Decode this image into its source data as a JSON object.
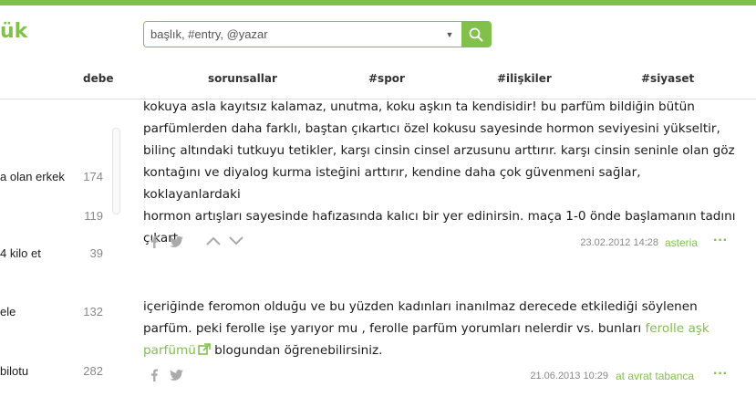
{
  "brand": {
    "logo_text": "ük",
    "accent_color": "#81c14b"
  },
  "search": {
    "placeholder": "başlık, #entry, @yazar"
  },
  "nav": {
    "items": [
      "debe",
      "sorunsallar",
      "#spor",
      "#ilişkiler",
      "#siyaset"
    ]
  },
  "sidebar": {
    "items": [
      {
        "label": "a olan erkek",
        "count": "174"
      },
      {
        "label": "",
        "count": "119"
      },
      {
        "label": "4 kilo et",
        "count": "39"
      },
      {
        "label": "ele",
        "count": "132"
      },
      {
        "label": "bilotu",
        "count": "282"
      }
    ]
  },
  "entries": [
    {
      "lines": [
        "kokuya asla kayıtsız kalamaz, unutma, koku aşkın ta kendisidir! bu parfüm bildiğin bütün",
        "parfümlerden daha farklı, baştan çıkartıcı özel kokusu sayesinde hormon seviyesini yükseltir,",
        "bilinç altındaki tutkuyu tetikler, karşı cinsin cinsel arzusunu arttırır. karşı cinsin seninle olan göz",
        "kontağını ve diyalog kurma isteğini arttırır, kendine daha çok güvenmeni sağlar, koklayanlardaki",
        "hormon artışları sayesinde hafızasında kalıcı bir yer edinirsin. maça 1-0 önde başlamanın tadını",
        "çıkart."
      ],
      "date": "23.02.2012 14:28",
      "author": "asteria"
    },
    {
      "line1": "içeriğinde feromon olduğu ve bu yüzden kadınları inanılmaz derecede etkilediği söylenen",
      "line2_text": "parfüm. peki ferolle işe yarıyor mu , ferolle parfüm yorumları nelerdir vs. bunları ",
      "line2_link": "ferolle aşk",
      "line3_link": "parfümü",
      "line3_text": " blogundan öğrenebilirsiniz.",
      "date": "21.06.2013 10:29",
      "author": "at avrat tabanca"
    }
  ],
  "icons": {
    "share_facebook": "facebook-icon",
    "share_twitter": "twitter-icon",
    "upvote": "chevron-up-icon",
    "downvote": "chevron-down-icon",
    "more": "more-icon",
    "external_link": "external-link-icon",
    "search": "search-icon"
  }
}
